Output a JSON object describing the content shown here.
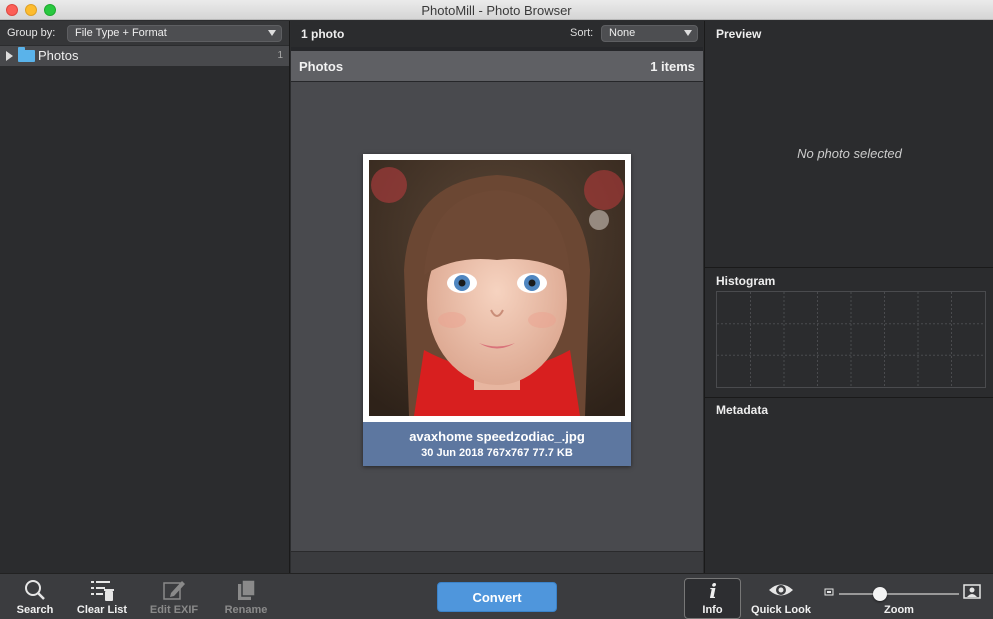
{
  "window": {
    "title": "PhotoMill - Photo Browser"
  },
  "left_panel": {
    "group_by_label": "Group by:",
    "group_by_value": "File Type + Format",
    "tree": [
      {
        "label": "Photos",
        "count": "1",
        "icon": "folder-icon"
      }
    ]
  },
  "center_panel": {
    "photo_count": "1 photo",
    "sort_label": "Sort:",
    "sort_value": "None",
    "section_title": "Photos",
    "section_count": "1 items",
    "items": [
      {
        "filename": "avaxhome speedzodiac_.jpg",
        "meta": "30 Jun 2018  767x767  77.7 KB"
      }
    ]
  },
  "right_panel": {
    "preview_title": "Preview",
    "preview_empty": "No photo selected",
    "histogram_title": "Histogram",
    "metadata_title": "Metadata"
  },
  "toolbar": {
    "search": "Search",
    "clear_list": "Clear List",
    "edit_exif": "Edit EXIF",
    "rename": "Rename",
    "convert": "Convert",
    "info": "Info",
    "quick_look": "Quick Look",
    "zoom": "Zoom",
    "zoom_level": 0.33
  },
  "colors": {
    "accent": "#4f96dc",
    "selection": "#5d77a0",
    "folder": "#5ab3ea"
  }
}
